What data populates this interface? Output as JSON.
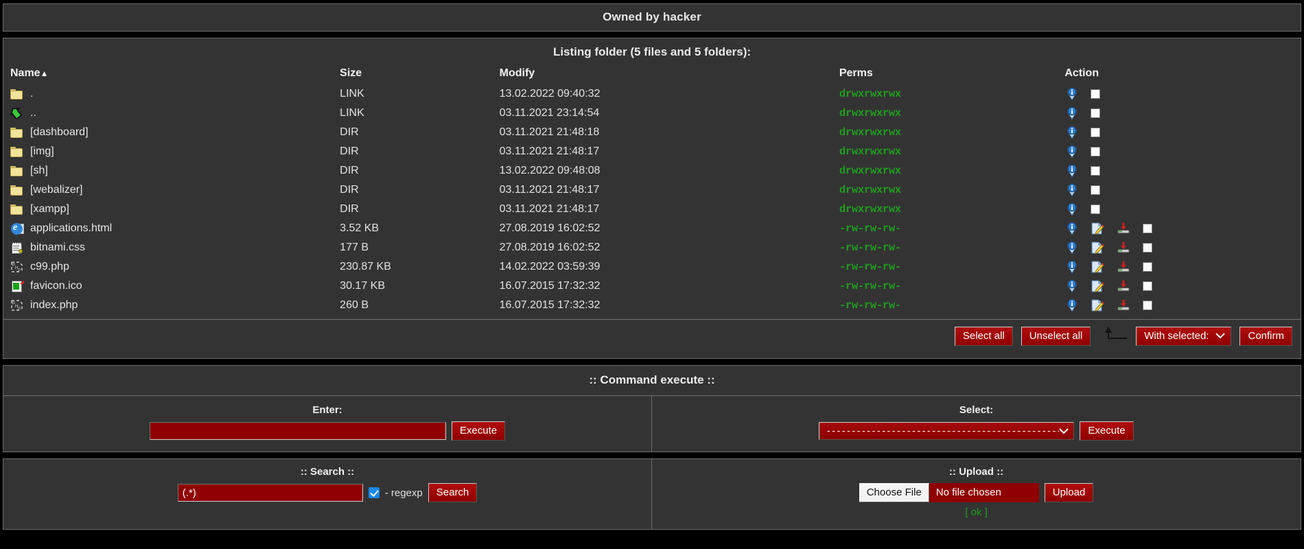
{
  "header": {
    "title": "Owned by hacker"
  },
  "listing": {
    "title": "Listing folder (5 files and 5 folders):",
    "columns": {
      "name": "Name",
      "sort_indicator": "▲",
      "size": "Size",
      "modify": "Modify",
      "perms": "Perms",
      "action": "Action"
    },
    "rows": [
      {
        "icon": "folder-icon",
        "name": ".",
        "size": "LINK",
        "modify": "13.02.2022 09:40:32",
        "perms": "drwxrwxrwx",
        "type": "dir"
      },
      {
        "icon": "up-arrow-icon",
        "name": "..",
        "size": "LINK",
        "modify": "03.11.2021 23:14:54",
        "perms": "drwxrwxrwx",
        "type": "dir"
      },
      {
        "icon": "folder-icon",
        "name": "[dashboard]",
        "size": "DIR",
        "modify": "03.11.2021 21:48:18",
        "perms": "drwxrwxrwx",
        "type": "dir"
      },
      {
        "icon": "folder-icon",
        "name": "[img]",
        "size": "DIR",
        "modify": "03.11.2021 21:48:17",
        "perms": "drwxrwxrwx",
        "type": "dir"
      },
      {
        "icon": "folder-icon",
        "name": "[sh]",
        "size": "DIR",
        "modify": "13.02.2022 09:48:08",
        "perms": "drwxrwxrwx",
        "type": "dir"
      },
      {
        "icon": "folder-icon",
        "name": "[webalizer]",
        "size": "DIR",
        "modify": "03.11.2021 21:48:17",
        "perms": "drwxrwxrwx",
        "type": "dir"
      },
      {
        "icon": "folder-icon",
        "name": "[xampp]",
        "size": "DIR",
        "modify": "03.11.2021 21:48:17",
        "perms": "drwxrwxrwx",
        "type": "dir"
      },
      {
        "icon": "html-file-icon",
        "name": "applications.html",
        "size": "3.52 KB",
        "modify": "27.08.2019 16:02:52",
        "perms": "-rw-rw-rw-",
        "type": "file"
      },
      {
        "icon": "css-file-icon",
        "name": "bitnami.css",
        "size": "177 B",
        "modify": "27.08.2019 16:02:52",
        "perms": "-rw-rw-rw-",
        "type": "file"
      },
      {
        "icon": "php-file-icon",
        "name": "c99.php",
        "size": "230.87 KB",
        "modify": "14.02.2022 03:59:39",
        "perms": "-rw-rw-rw-",
        "type": "file"
      },
      {
        "icon": "ico-file-icon",
        "name": "favicon.ico",
        "size": "30.17 KB",
        "modify": "16.07.2015 17:32:32",
        "perms": "-rw-rw-rw-",
        "type": "file"
      },
      {
        "icon": "php-file-icon",
        "name": "index.php",
        "size": "260 B",
        "modify": "16.07.2015 17:32:32",
        "perms": "-rw-rw-rw-",
        "type": "file"
      }
    ]
  },
  "toolbar": {
    "select_all": "Select all",
    "unselect_all": "Unselect all",
    "with_selected": "With selected:",
    "confirm": "Confirm"
  },
  "command_execute": {
    "title": ":: Command execute ::",
    "enter_label": "Enter:",
    "enter_value": "",
    "enter_placeholder": "",
    "execute_left": "Execute",
    "select_label": "Select:",
    "select_value": "-----------------------------------------------------------------",
    "execute_right": "Execute"
  },
  "search": {
    "title": ":: Search ::",
    "value": "(.*)",
    "regexp_label": "- regexp",
    "regexp_checked": true,
    "button": "Search"
  },
  "upload": {
    "title": ":: Upload ::",
    "choose_file": "Choose File",
    "file_status": "No file chosen",
    "button": "Upload",
    "status": "[ ok ]"
  },
  "colors": {
    "panel_bg": "#333333",
    "panel_border": "#6d6d6d",
    "page_bg": "#000000",
    "accent_red": "#8f0000",
    "perm_green": "#1f9e1f",
    "text": "#e6e6e6"
  }
}
